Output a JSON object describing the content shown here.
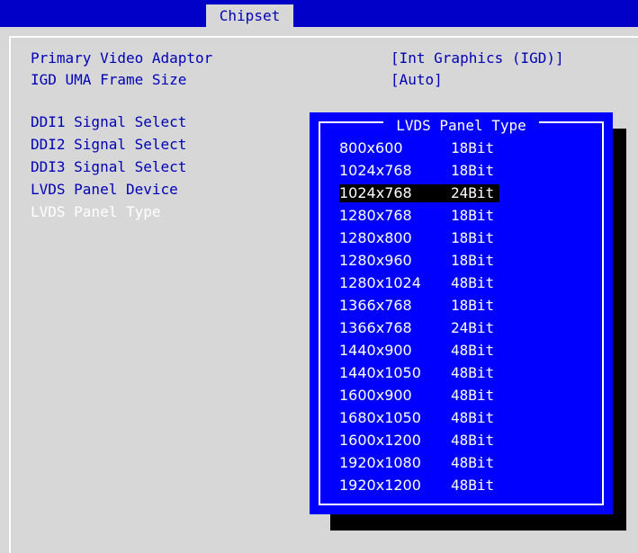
{
  "header": {
    "tab_label": "Chipset"
  },
  "settings": [
    {
      "label": "Primary Video Adaptor",
      "value": "[Int Graphics (IGD)]"
    },
    {
      "label": "IGD UMA Frame Size",
      "value": "[Auto]"
    },
    {
      "label": "DDI1 Signal Select",
      "value": ""
    },
    {
      "label": "DDI2 Signal Select",
      "value": ""
    },
    {
      "label": "DDI3 Signal Select",
      "value": ""
    },
    {
      "label": "LVDS Panel Device",
      "value": ""
    },
    {
      "label": "LVDS Panel Type",
      "value": ""
    }
  ],
  "popup": {
    "title": "LVDS Panel Type",
    "options": [
      {
        "resolution": "800x600",
        "bit": "18Bit"
      },
      {
        "resolution": "1024x768",
        "bit": "18Bit"
      },
      {
        "resolution": "1024x768",
        "bit": "24Bit"
      },
      {
        "resolution": "1280x768",
        "bit": "18Bit"
      },
      {
        "resolution": "1280x800",
        "bit": "18Bit"
      },
      {
        "resolution": "1280x960",
        "bit": "18Bit"
      },
      {
        "resolution": "1280x1024",
        "bit": "48Bit"
      },
      {
        "resolution": "1366x768",
        "bit": "18Bit"
      },
      {
        "resolution": "1366x768",
        "bit": "24Bit"
      },
      {
        "resolution": "1440x900",
        "bit": "48Bit"
      },
      {
        "resolution": "1440x1050",
        "bit": "48Bit"
      },
      {
        "resolution": "1600x900",
        "bit": "48Bit"
      },
      {
        "resolution": "1680x1050",
        "bit": "48Bit"
      },
      {
        "resolution": "1600x1200",
        "bit": "48Bit"
      },
      {
        "resolution": "1920x1080",
        "bit": "48Bit"
      },
      {
        "resolution": "1920x1200",
        "bit": "48Bit"
      }
    ]
  },
  "colors": {
    "header_bar": "#0000c8",
    "panel_background": "#d7d7d7",
    "text": "#0000b4",
    "popup_background": "#0000ff",
    "popup_text": "#ffffff",
    "highlight": "#000000"
  }
}
